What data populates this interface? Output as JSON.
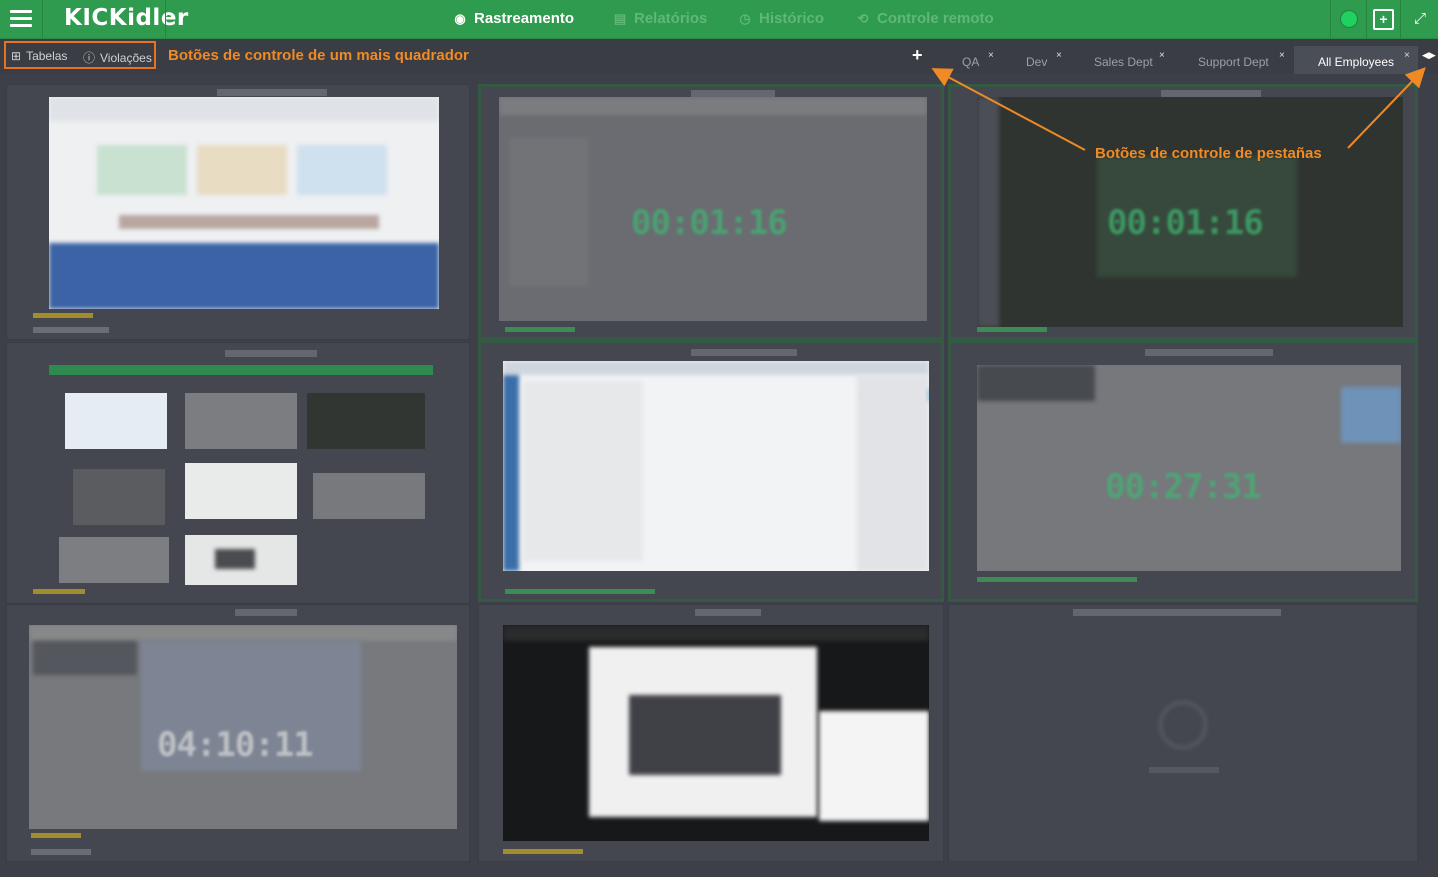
{
  "app": {
    "logo": "KICKidler",
    "nav": [
      {
        "label": "Rastreamento",
        "icon": "eye-icon",
        "active": true
      },
      {
        "label": "Relatórios",
        "icon": "document-icon",
        "active": false
      },
      {
        "label": "Histórico",
        "icon": "history-icon",
        "active": false
      },
      {
        "label": "Controle remoto",
        "icon": "remote-icon",
        "active": false
      }
    ]
  },
  "toolbar": {
    "tables_label": "Tabelas",
    "violations_label": "Violações",
    "annotation_left": "Botões de controle de um mais quadrador",
    "annotation_tabs": "Botões de controle de pestañas",
    "add_tab": "+"
  },
  "tabs": [
    {
      "label": "QA",
      "active": false
    },
    {
      "label": "Dev",
      "active": false
    },
    {
      "label": "Sales Dept",
      "active": false
    },
    {
      "label": "Support Dept",
      "active": false
    },
    {
      "label": "All Employees",
      "active": true
    }
  ],
  "tab_close": "×",
  "timers": {
    "t1": "00:01:16",
    "t2": "00:01:16",
    "t3": "00:27:31",
    "t4": "04:10:11"
  },
  "colors": {
    "topbar": "#2f9b4f",
    "accent_orange": "#e8731e",
    "status_online": "#1fd15e",
    "timer_green": "#3fb773"
  }
}
